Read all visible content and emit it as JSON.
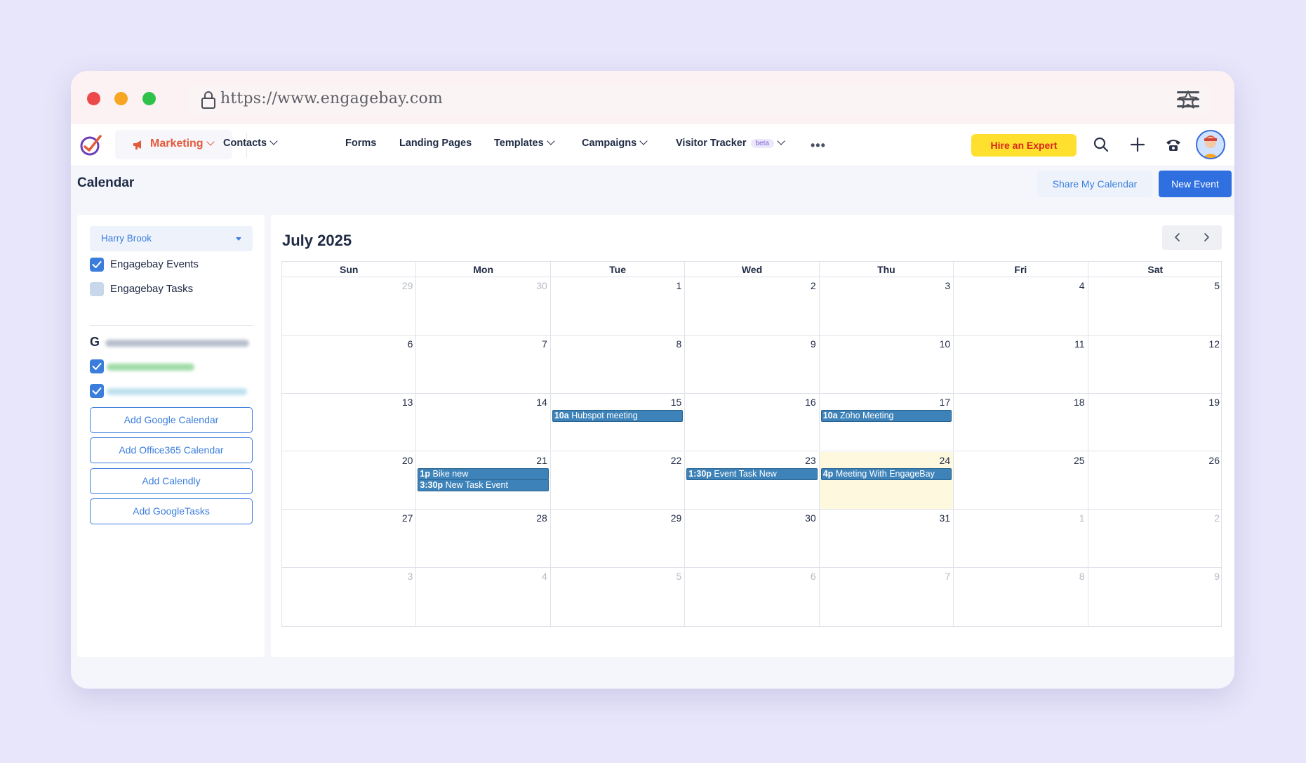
{
  "browser": {
    "url": "https://www.engagebay.com"
  },
  "nav": {
    "marketing_label": "Marketing",
    "items": [
      {
        "label": "Contacts",
        "has_dropdown": true
      },
      {
        "label": "Forms",
        "has_dropdown": false
      },
      {
        "label": "Landing Pages",
        "has_dropdown": false
      },
      {
        "label": "Templates",
        "has_dropdown": true
      },
      {
        "label": "Campaigns",
        "has_dropdown": true
      },
      {
        "label": "Visitor Tracker",
        "has_dropdown": true,
        "badge": "beta"
      }
    ],
    "hire_label": "Hire an Expert"
  },
  "page": {
    "title": "Calendar",
    "share_label": "Share My Calendar",
    "new_event_label": "New Event"
  },
  "sidebar": {
    "user": "Harry Brook",
    "calendars": [
      {
        "label": "Engagebay Events",
        "checked": true
      },
      {
        "label": "Engagebay Tasks",
        "checked": false
      }
    ],
    "buttons": {
      "google": "Add Google Calendar",
      "office": "Add Office365 Calendar",
      "calendly": "Add Calendly",
      "gtasks": "Add GoogleTasks"
    }
  },
  "calendar": {
    "month_title": "July 2025",
    "weekdays": [
      "Sun",
      "Mon",
      "Tue",
      "Wed",
      "Thu",
      "Fri",
      "Sat"
    ],
    "weeks": [
      [
        {
          "d": "29",
          "m": true
        },
        {
          "d": "30",
          "m": true
        },
        {
          "d": "1"
        },
        {
          "d": "2"
        },
        {
          "d": "3"
        },
        {
          "d": "4"
        },
        {
          "d": "5"
        }
      ],
      [
        {
          "d": "6"
        },
        {
          "d": "7"
        },
        {
          "d": "8"
        },
        {
          "d": "9"
        },
        {
          "d": "10"
        },
        {
          "d": "11"
        },
        {
          "d": "12"
        }
      ],
      [
        {
          "d": "13"
        },
        {
          "d": "14"
        },
        {
          "d": "15",
          "events": [
            {
              "time": "10a",
              "title": "Hubspot meeting"
            }
          ]
        },
        {
          "d": "16"
        },
        {
          "d": "17",
          "events": [
            {
              "time": "10a",
              "title": "Zoho Meeting"
            }
          ]
        },
        {
          "d": "18"
        },
        {
          "d": "19"
        }
      ],
      [
        {
          "d": "20"
        },
        {
          "d": "21",
          "events": [
            {
              "time": "1p",
              "title": "Bike new"
            },
            {
              "time": "3:30p",
              "title": "New Task Event"
            }
          ]
        },
        {
          "d": "22"
        },
        {
          "d": "23",
          "events": [
            {
              "time": "1:30p",
              "title": "Event Task New"
            }
          ]
        },
        {
          "d": "24",
          "today": true,
          "events": [
            {
              "time": "4p",
              "title": "Meeting With EngageBay"
            }
          ]
        },
        {
          "d": "25"
        },
        {
          "d": "26"
        }
      ],
      [
        {
          "d": "27"
        },
        {
          "d": "28"
        },
        {
          "d": "29"
        },
        {
          "d": "30"
        },
        {
          "d": "31"
        },
        {
          "d": "1",
          "m": true
        },
        {
          "d": "2",
          "m": true
        }
      ],
      [
        {
          "d": "3",
          "m": true
        },
        {
          "d": "4",
          "m": true
        },
        {
          "d": "5",
          "m": true
        },
        {
          "d": "6",
          "m": true
        },
        {
          "d": "7",
          "m": true
        },
        {
          "d": "8",
          "m": true
        },
        {
          "d": "9",
          "m": true
        }
      ]
    ]
  },
  "colors": {
    "accent": "#2f6fe0",
    "event": "#3d82b8",
    "today": "#fdf8de",
    "hire_bg": "#ffe02e",
    "hire_text": "#d8261c",
    "marketing": "#e35a3b"
  }
}
